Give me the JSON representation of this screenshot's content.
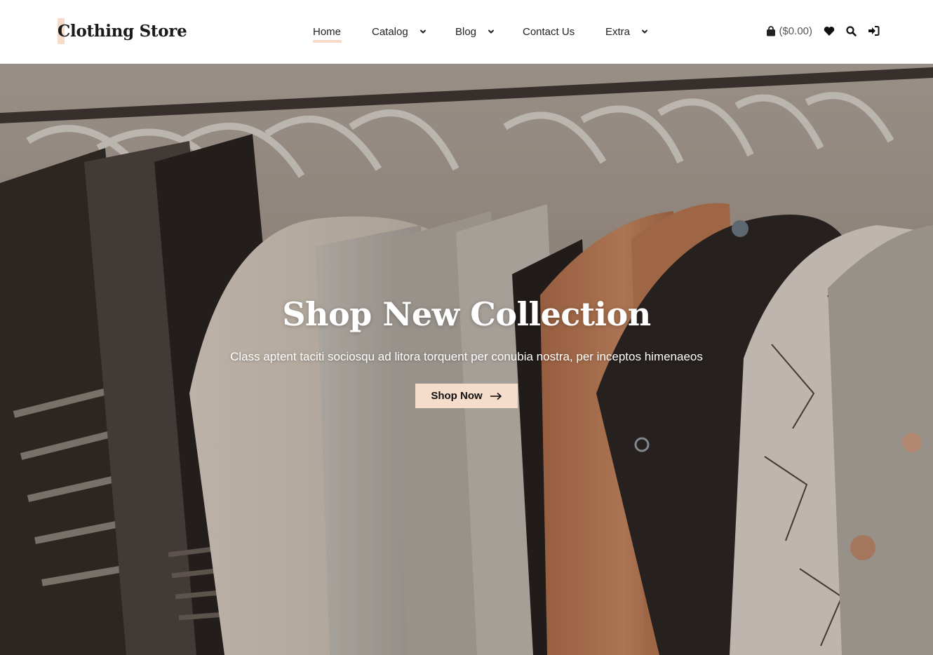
{
  "header": {
    "logo": "Clothing Store",
    "nav": [
      {
        "label": "Home",
        "active": true
      },
      {
        "label": "Catalog",
        "dropdown": true
      },
      {
        "label": "Blog",
        "dropdown": true
      },
      {
        "label": "Contact Us"
      },
      {
        "label": "Extra",
        "dropdown": true
      }
    ],
    "cart_total": "($0.00)",
    "icons": [
      "cart-icon",
      "heart-icon",
      "search-icon",
      "login-icon"
    ]
  },
  "hero": {
    "title": "Shop New Collection",
    "subtitle": "Class aptent taciti sociosqu ad litora torquent per conubia nostra, per inceptos himenaeos",
    "button_label": "Shop Now"
  },
  "colors": {
    "accent": "#f6dccb",
    "text": "#222222"
  }
}
